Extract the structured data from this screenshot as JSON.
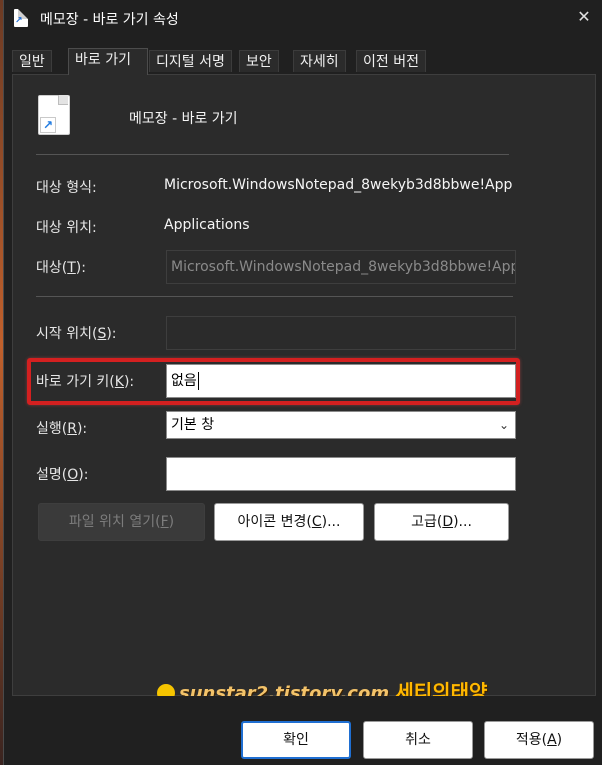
{
  "window": {
    "title": "메모장 - 바로 가기 속성",
    "close_glyph": "✕"
  },
  "tabs": [
    "일반",
    "바로 가기",
    "디지털 서명",
    "보안",
    "자세히",
    "이전 버전"
  ],
  "active_tab": "바로 가기",
  "header": {
    "name": "메모장 - 바로 가기",
    "icon": "notepad-shortcut-icon"
  },
  "fields": {
    "target_type": {
      "label": "대상 형식:",
      "value": "Microsoft.WindowsNotepad_8wekyb3d8bbwe!App"
    },
    "target_location": {
      "label": "대상 위치:",
      "value": "Applications"
    },
    "target": {
      "label_prefix": "대상(",
      "key": "T",
      "label_suffix": "):",
      "value": "Microsoft.WindowsNotepad_8wekyb3d8bbwe!App"
    },
    "start_in": {
      "label_prefix": "시작 위치(",
      "key": "S",
      "label_suffix": "):",
      "value": ""
    },
    "shortcut_key": {
      "label_prefix": "바로 가기 키(",
      "key": "K",
      "label_suffix": "):",
      "value": "없음"
    },
    "run": {
      "label_prefix": "실행(",
      "key": "R",
      "label_suffix": "):",
      "value": "기본 창"
    },
    "comment": {
      "label_prefix": "설명(",
      "key": "O",
      "label_suffix": "):",
      "value": ""
    }
  },
  "buttons": {
    "open_location": {
      "text": "파일 위치 열기(",
      "key": "F",
      "suffix": ")"
    },
    "change_icon": {
      "text": "아이콘 변경(",
      "key": "C",
      "suffix": ")..."
    },
    "advanced": {
      "text": "고급(",
      "key": "D",
      "suffix": ")..."
    },
    "ok": "확인",
    "cancel": "취소",
    "apply": {
      "text": "적용(",
      "key": "A",
      "suffix": ")"
    }
  },
  "watermark": {
    "url": "sunstar2.tistory.com",
    "name": "세티의태양"
  },
  "colors": {
    "highlight": "#d42020",
    "accent": "#1f6fd2",
    "bg": "#202020",
    "panel": "#2b2b2b"
  }
}
